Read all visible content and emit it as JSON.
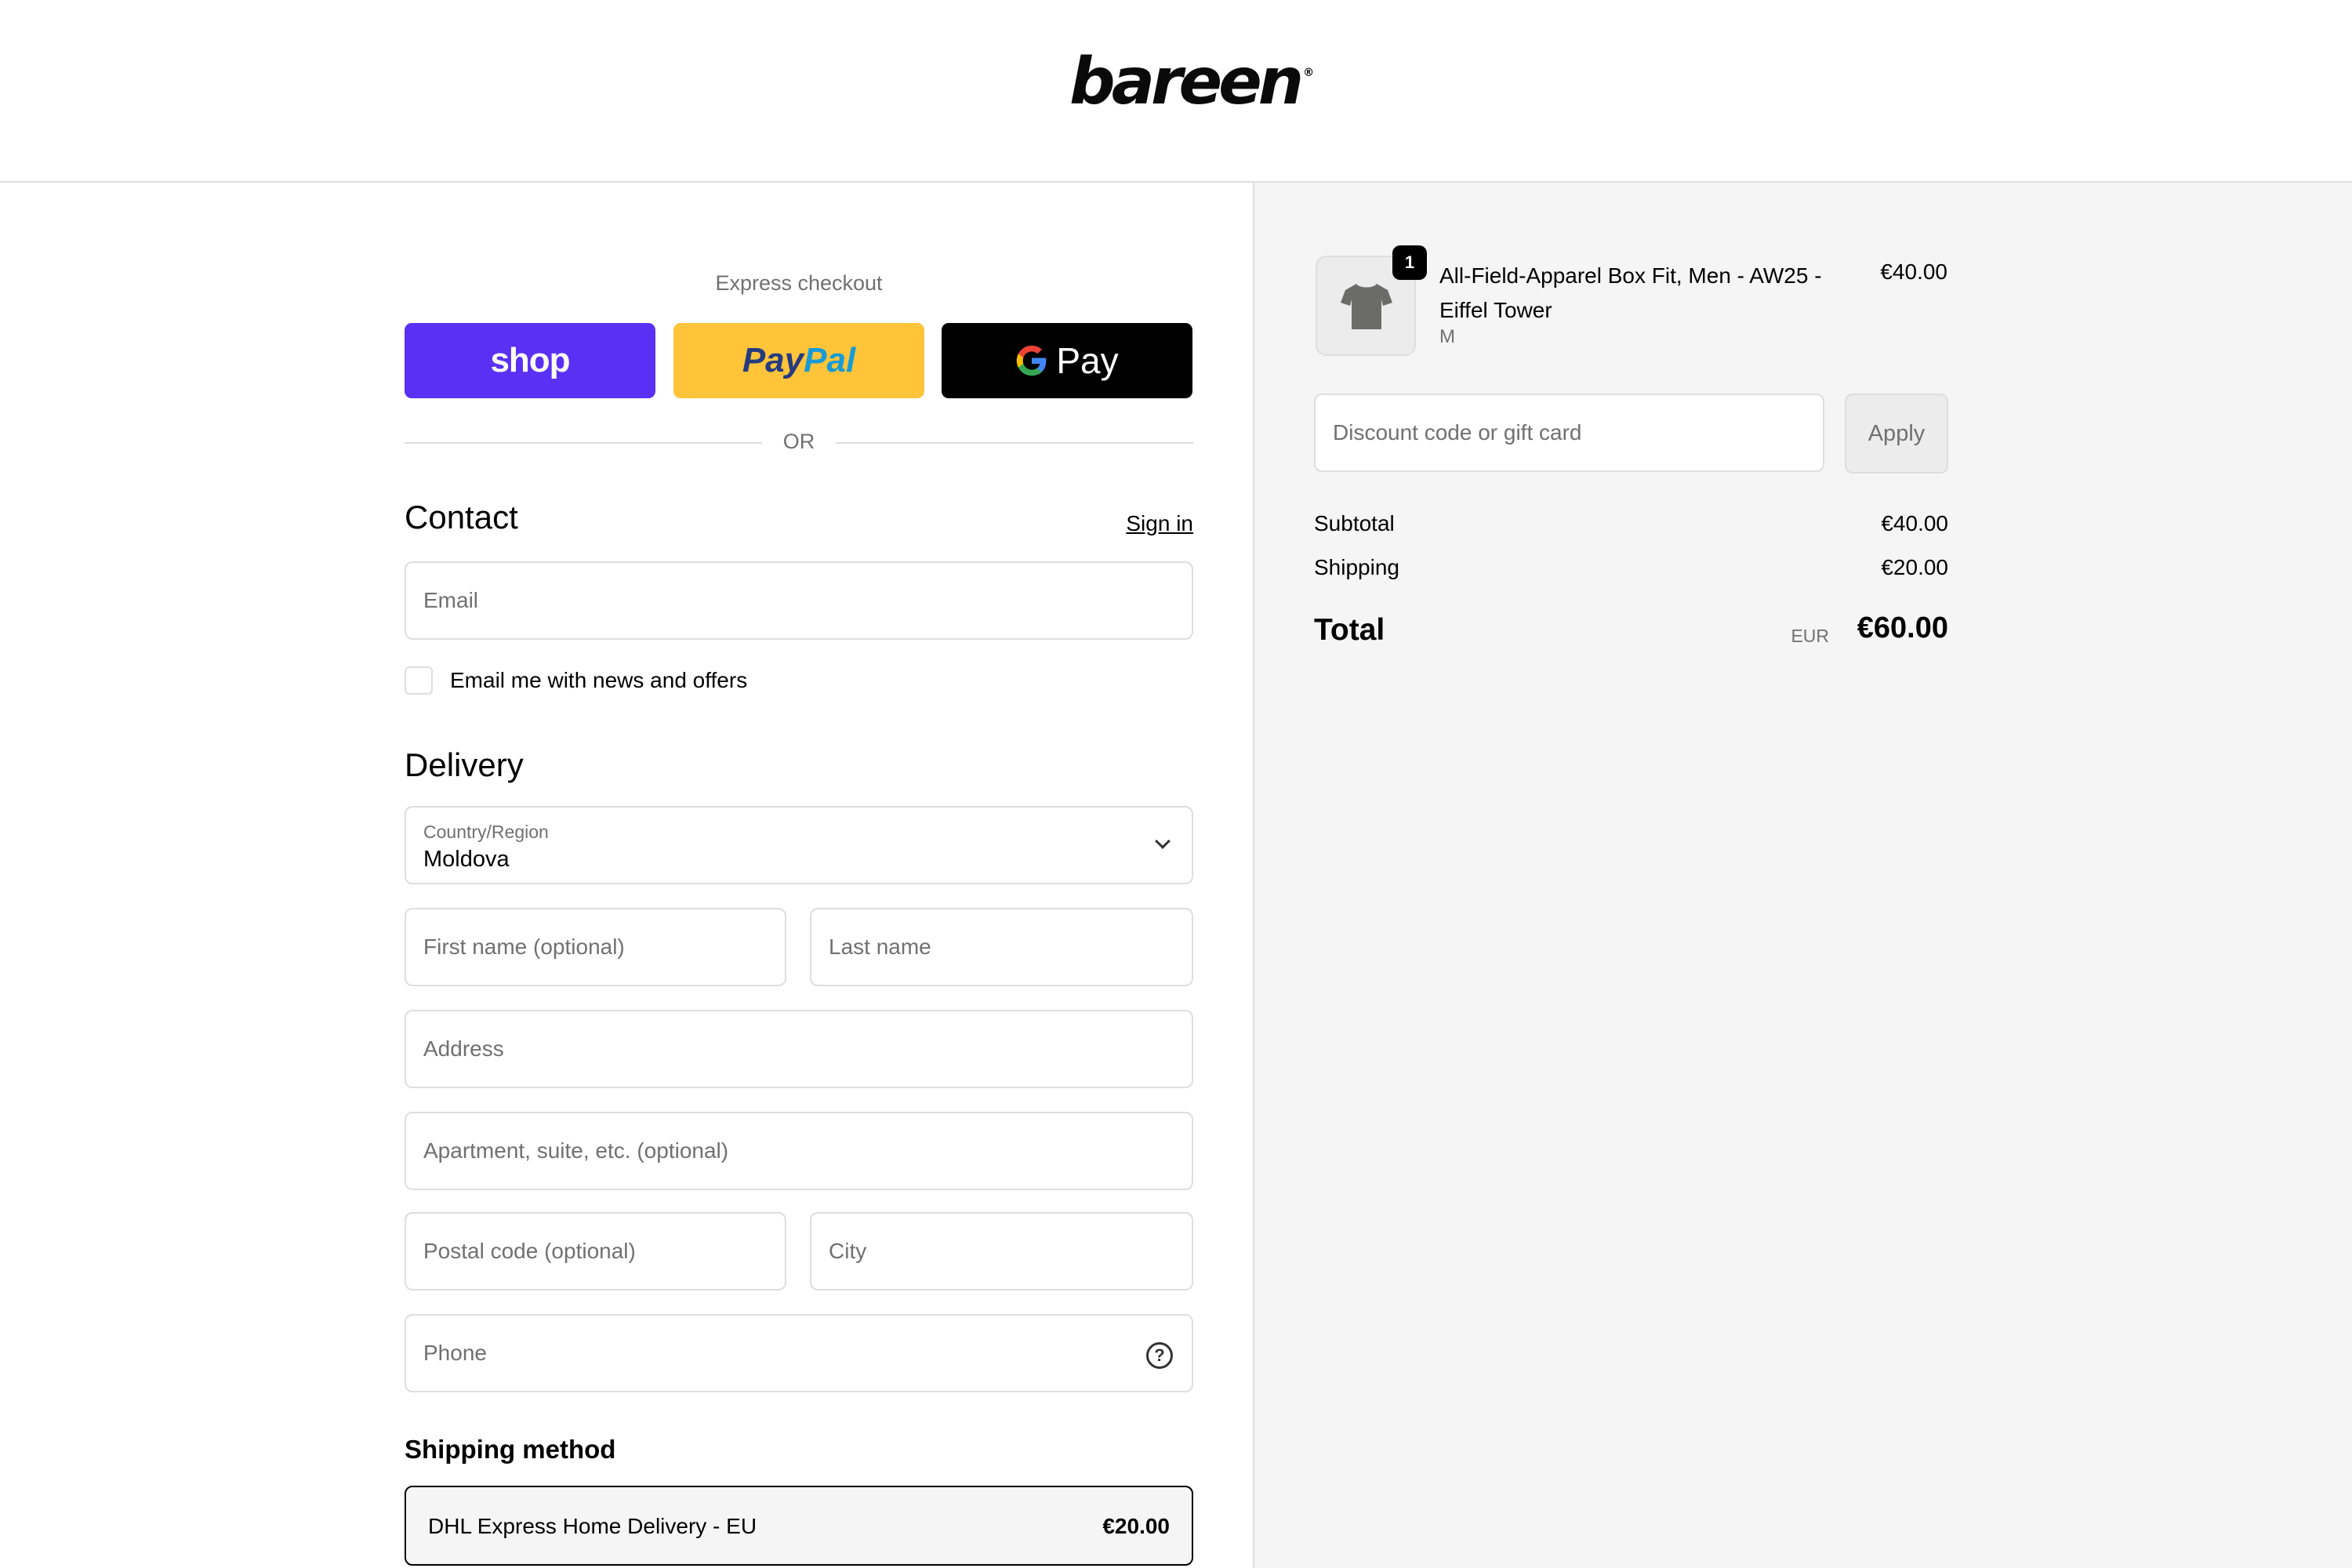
{
  "brand": {
    "logo_text": "bareen",
    "trademark": "®"
  },
  "express": {
    "label": "Express checkout",
    "shop_label": "shop",
    "paypal_part1": "Pay",
    "paypal_part2": "Pal",
    "gpay_g": "G",
    "gpay_label": "Pay",
    "or_text": "OR"
  },
  "contact": {
    "title": "Contact",
    "sign_in": "Sign in",
    "email_placeholder": "Email",
    "newsletter_label": "Email me with news and offers",
    "newsletter_checked": false
  },
  "delivery": {
    "title": "Delivery",
    "country_label": "Country/Region",
    "country_value": "Moldova",
    "first_name_placeholder": "First name (optional)",
    "last_name_placeholder": "Last name",
    "address_placeholder": "Address",
    "apartment_placeholder": "Apartment, suite, etc. (optional)",
    "postal_placeholder": "Postal code (optional)",
    "city_placeholder": "City",
    "phone_placeholder": "Phone",
    "phone_help_icon": "?"
  },
  "shipping": {
    "title": "Shipping method",
    "option_name": "DHL Express Home Delivery - EU",
    "option_price": "€20.00"
  },
  "summary": {
    "item": {
      "quantity": "1",
      "name": "All-Field-Apparel Box Fit, Men - AW25 - Eiffel Tower",
      "variant": "M",
      "price": "€40.00",
      "thumbnail_icon": "tshirt-icon"
    },
    "discount_placeholder": "Discount code or gift card",
    "apply_label": "Apply",
    "subtotal_label": "Subtotal",
    "subtotal_value": "€40.00",
    "shipping_label": "Shipping",
    "shipping_value": "€20.00",
    "total_label": "Total",
    "currency": "EUR",
    "total_value": "€60.00"
  },
  "colors": {
    "shop_purple": "#5a31f4",
    "paypal_yellow": "#ffc439",
    "gpay_black": "#000000",
    "summary_bg": "#f5f5f5"
  }
}
